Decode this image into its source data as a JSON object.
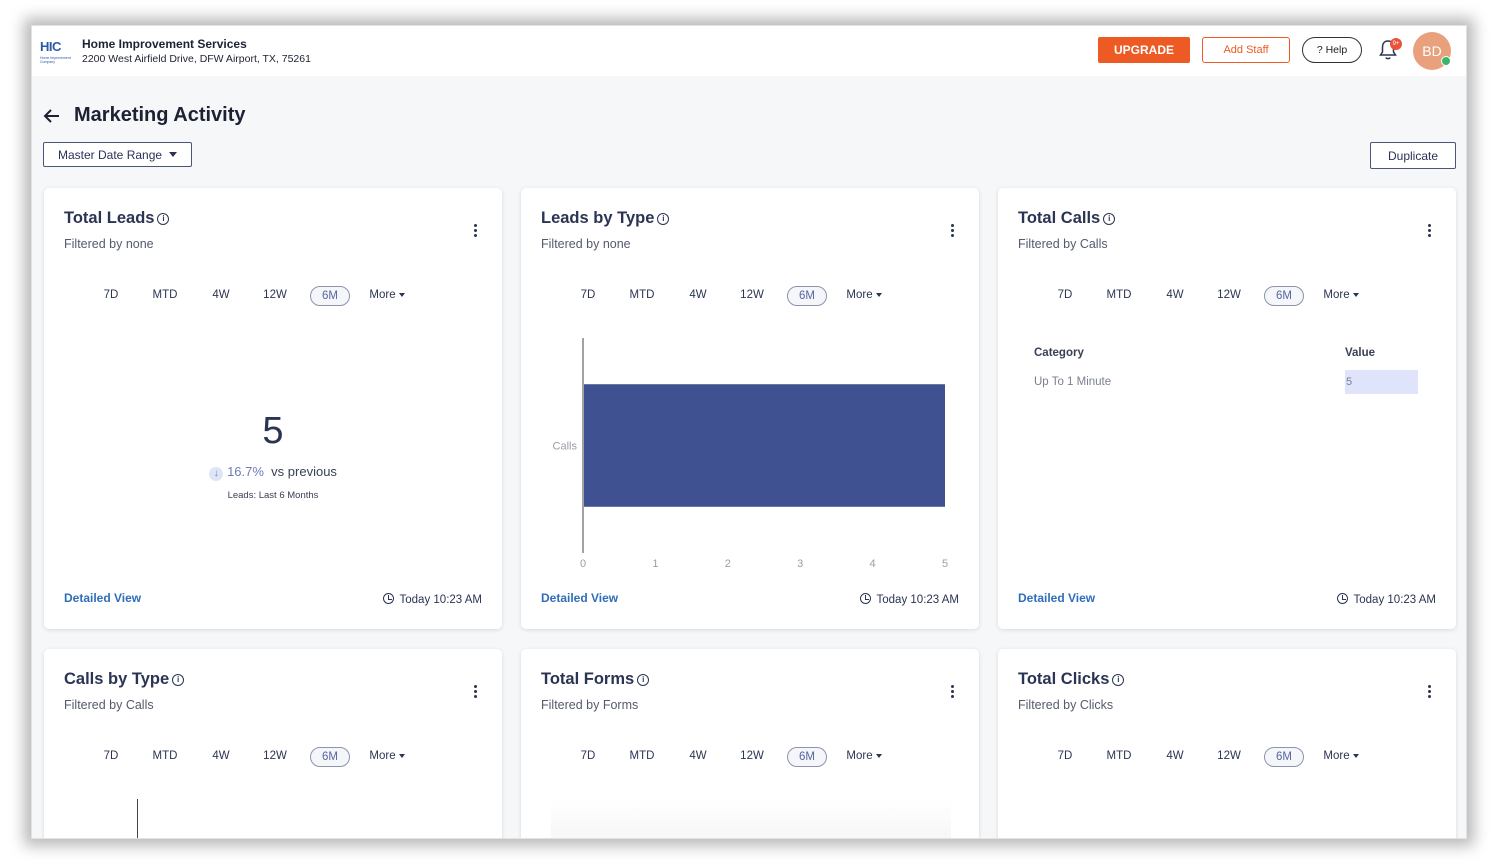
{
  "header": {
    "logo_text": "HIC",
    "logo_subtext": "Home Improvement Company",
    "company_name": "Home Improvement Services",
    "company_address": "2200 West Airfield Drive, DFW Airport, TX, 75261",
    "upgrade_label": "UPGRADE",
    "add_staff_label": "Add Staff",
    "help_label": "? Help",
    "notification_badge": "9+",
    "avatar_initials": "BD"
  },
  "page": {
    "title": "Marketing Activity",
    "date_range_label": "Master Date Range",
    "duplicate_label": "Duplicate"
  },
  "ranges": [
    "7D",
    "MTD",
    "4W",
    "12W",
    "6M"
  ],
  "more_label": "More",
  "cards": [
    {
      "title": "Total Leads",
      "filter": "Filtered by none",
      "detailed": "Detailed View",
      "updated": "Today 10:23 AM"
    },
    {
      "title": "Leads by Type",
      "filter": "Filtered by none",
      "detailed": "Detailed View",
      "updated": "Today 10:23 AM"
    },
    {
      "title": "Total Calls",
      "filter": "Filtered by Calls",
      "detailed": "Detailed View",
      "updated": "Today 10:23 AM"
    },
    {
      "title": "Calls by Type",
      "filter": "Filtered by Calls"
    },
    {
      "title": "Total Forms",
      "filter": "Filtered by Forms"
    },
    {
      "title": "Total Clicks",
      "filter": "Filtered by Clicks"
    }
  ],
  "total_leads": {
    "value": "5",
    "change_pct": "16.7%",
    "change_text": "vs previous",
    "caption": "Leads: Last 6 Months"
  },
  "total_calls_table": {
    "headers": [
      "Category",
      "Value"
    ],
    "rows": [
      {
        "category": "Up To 1 Minute",
        "value": "5"
      }
    ]
  },
  "chart_data": {
    "type": "bar",
    "orientation": "horizontal",
    "categories": [
      "Calls"
    ],
    "values": [
      5
    ],
    "xlim": [
      0,
      5
    ],
    "xticks": [
      "0",
      "1",
      "2",
      "3",
      "4",
      "5"
    ],
    "color": "#3f5190"
  }
}
